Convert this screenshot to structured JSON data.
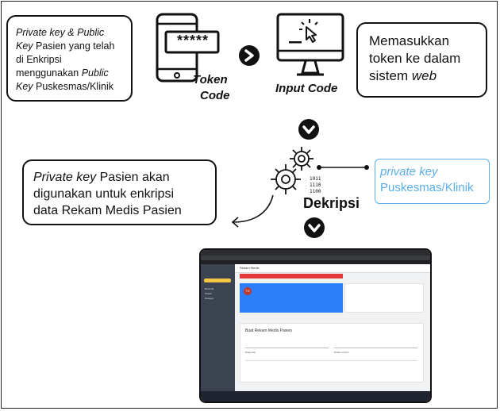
{
  "box_keys": {
    "line1a": "Private key & Public",
    "line2a": "Key",
    "line2b": " Pasien yang telah",
    "line3": "di Enkripsi",
    "line4a": "menggunakan ",
    "line4b": "Public",
    "line5a": "Key",
    "line5b": " Puskesmas/Klinik"
  },
  "token_code": {
    "password": "*****",
    "label1": "Token",
    "label2": "Code"
  },
  "input_code": {
    "label": "Input Code"
  },
  "box_enter": {
    "line1": "Memasukkan",
    "line2": "token ke dalam",
    "line3a": "sistem ",
    "line3b": "web"
  },
  "box_private": {
    "line1a": "Private key",
    "line1b": " Pasien akan",
    "line2": "digunakan untuk enkripsi",
    "line3": "data Rekam Medis Pasien"
  },
  "decrypt": {
    "label": "Dekripsi",
    "bits": [
      "1011",
      "1110",
      "1100"
    ]
  },
  "box_clinic": {
    "line1": "private key",
    "line2": "Puskesmas/Klinik",
    "color": "#5aaee8"
  },
  "screenshot": {
    "title": "Rekam Medis",
    "button": "Buat Rekam Medis",
    "sidebar": [
      "Beranda",
      "Pasien",
      "Riwayat"
    ],
    "patient_initials": "TS",
    "section_title": "Buat Rekam Medis Pasien",
    "diagnosis": "Diagnosis",
    "doctor": "Dokter Umum"
  }
}
